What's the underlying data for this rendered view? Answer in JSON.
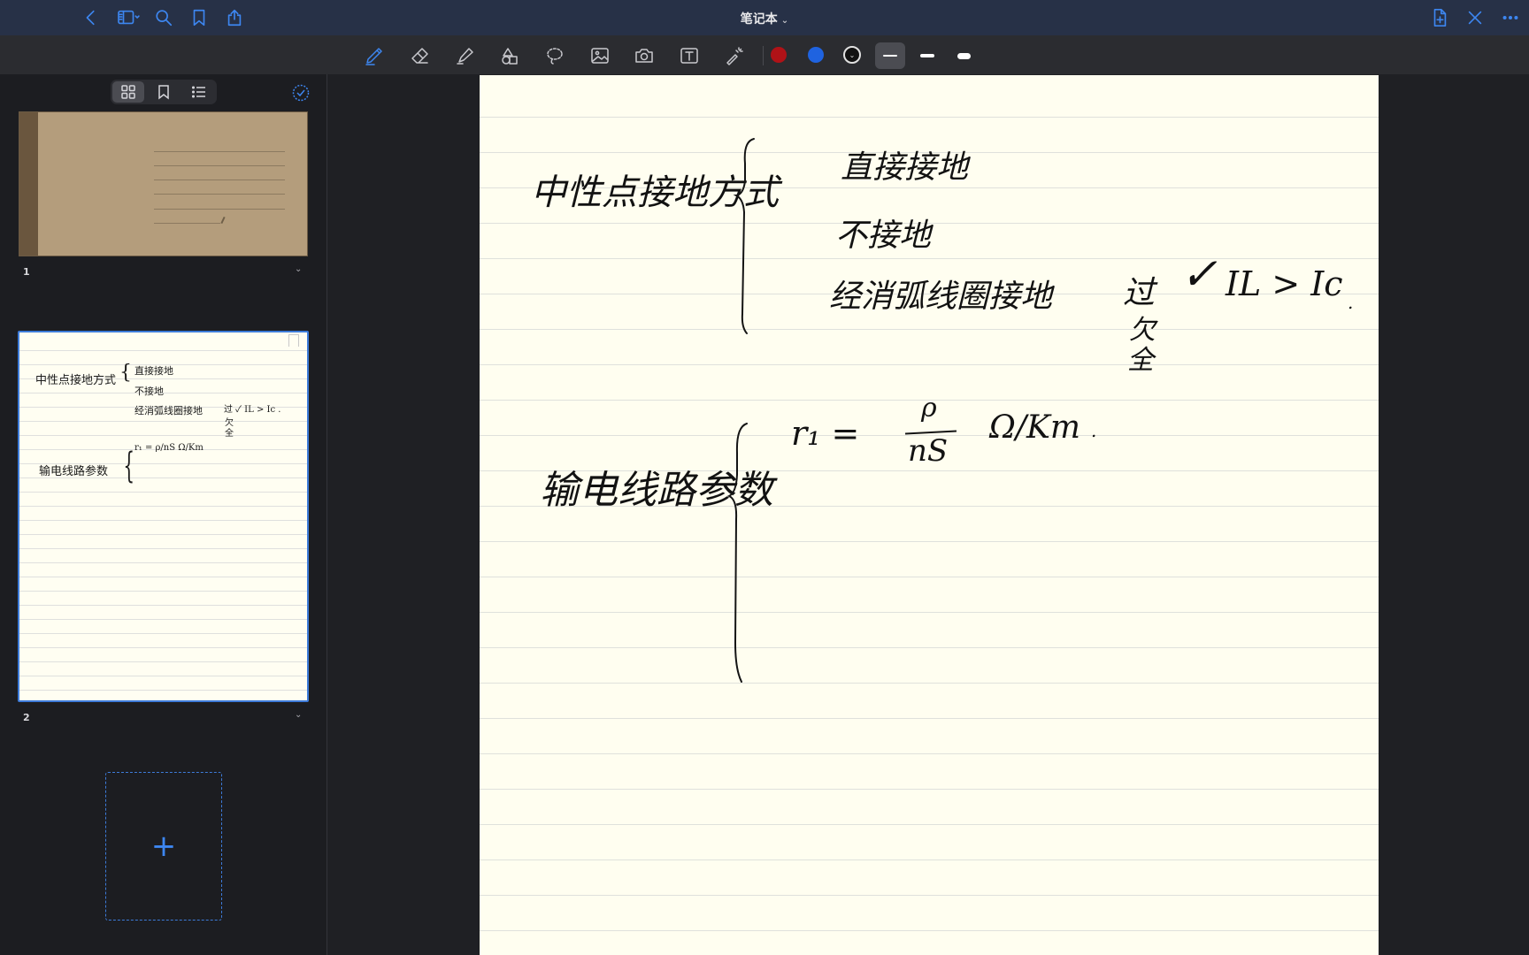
{
  "app": {
    "title": "笔记本",
    "title_chevron": "⌄"
  },
  "titlebar_icons": {
    "left": [
      "back-icon",
      "sidebar-toggle-icon",
      "search-icon",
      "bookmark-icon",
      "share-icon"
    ],
    "right": [
      "add-page-icon",
      "close-icon",
      "more-icon"
    ]
  },
  "toolbar": {
    "tools": [
      "pen-icon",
      "eraser-icon",
      "highlighter-icon",
      "shapes-icon",
      "lasso-icon",
      "image-icon",
      "camera-icon",
      "textbox-icon",
      "laser-pointer-icon"
    ],
    "active_tool": "pen",
    "colors": [
      "#b01217",
      "#1f63e0",
      "#111111"
    ],
    "stroke_widths": [
      "thin",
      "medium",
      "thick"
    ],
    "active_width": "thin"
  },
  "sidebar": {
    "view_modes": [
      "grid-view-icon",
      "bookmark-view-icon",
      "outline-view-icon"
    ],
    "active_view": "grid",
    "pages": [
      {
        "number": "1",
        "chevron": "⌄"
      },
      {
        "number": "2",
        "chevron": "⌄"
      }
    ],
    "add_page_symbol": "+"
  },
  "thumbnail_text": {
    "topic1": "中性点接地方式",
    "items1": [
      "直接接地",
      "不接地",
      "经消弧线圈接地"
    ],
    "note1": "过 ✓ IL > Ic .",
    "note1b": "欠",
    "note1c": "全",
    "topic2": "输电线路参数",
    "formula": "r₁ = ρ/nS   Ω/Km"
  },
  "note": {
    "topic1": "中性点接地方式",
    "item1": "直接接地",
    "item2": "不接地",
    "item3": "经消弧线圈接地",
    "over_label": "过",
    "check": "✓",
    "inequality": "IL > Ic",
    "dot1": ".",
    "under_label": "欠",
    "full_label": "全",
    "topic2": "输电线路参数",
    "r_symbol": "r₁ =",
    "rho": "ρ",
    "denominator": "nS",
    "unit": "Ω/Km",
    "dot2": "."
  }
}
